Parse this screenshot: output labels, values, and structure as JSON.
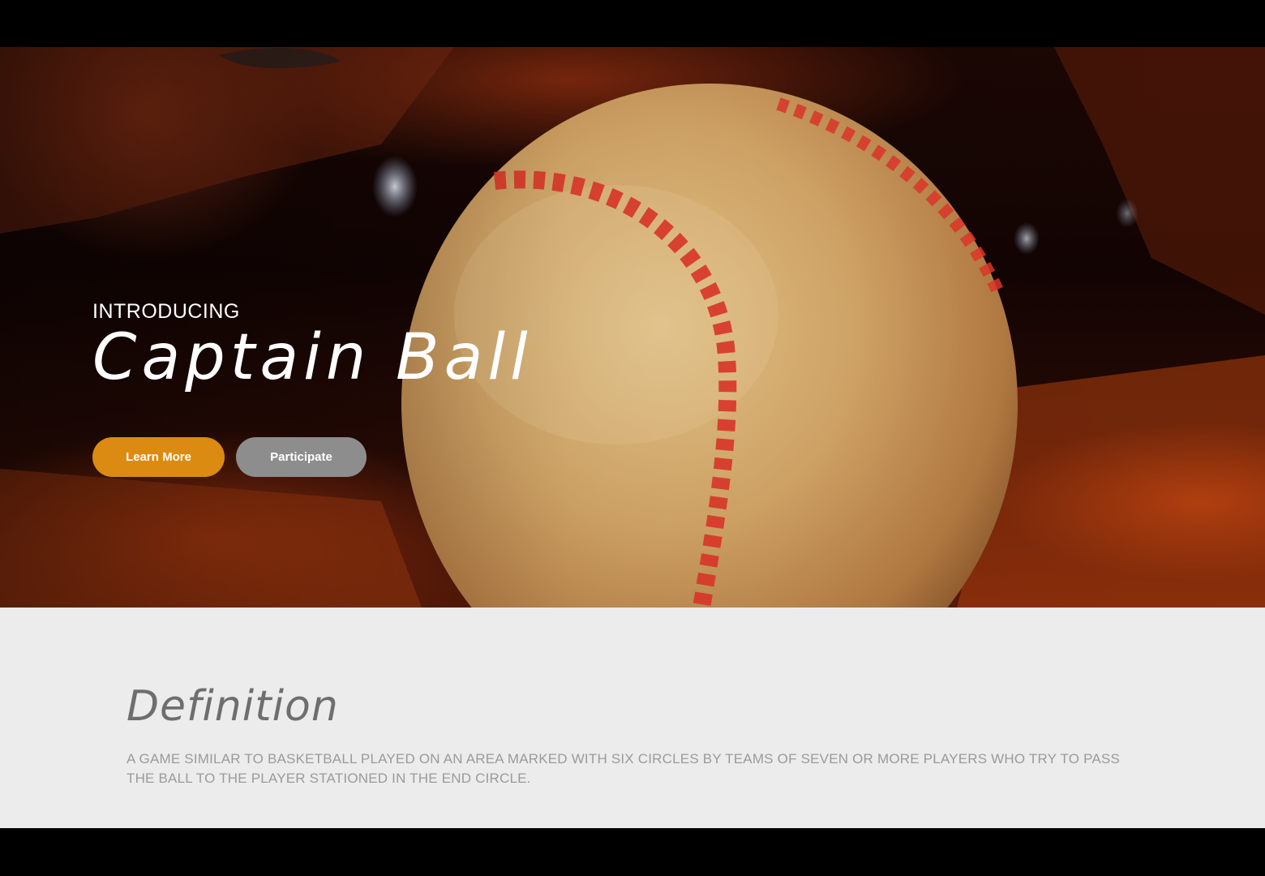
{
  "hero": {
    "eyebrow": "INTRODUCING",
    "title": "Captain Ball",
    "buttons": {
      "learn_more": "Learn More",
      "participate": "Participate"
    }
  },
  "definition": {
    "heading": "Definition",
    "text": "A GAME SIMILAR TO BASKETBALL PLAYED ON AN AREA MARKED WITH SIX CIRCLES BY TEAMS OF SEVEN OR MORE PLAYERS WHO TRY TO PASS THE BALL TO THE PLAYER STATIONED IN THE END CIRCLE."
  },
  "colors": {
    "primary_button": "#dc8b12",
    "secondary_button": "#8d8d8d",
    "section_background": "#ececec",
    "stitch_red": "#e0362a"
  },
  "hero_image": "baseball-in-glove"
}
